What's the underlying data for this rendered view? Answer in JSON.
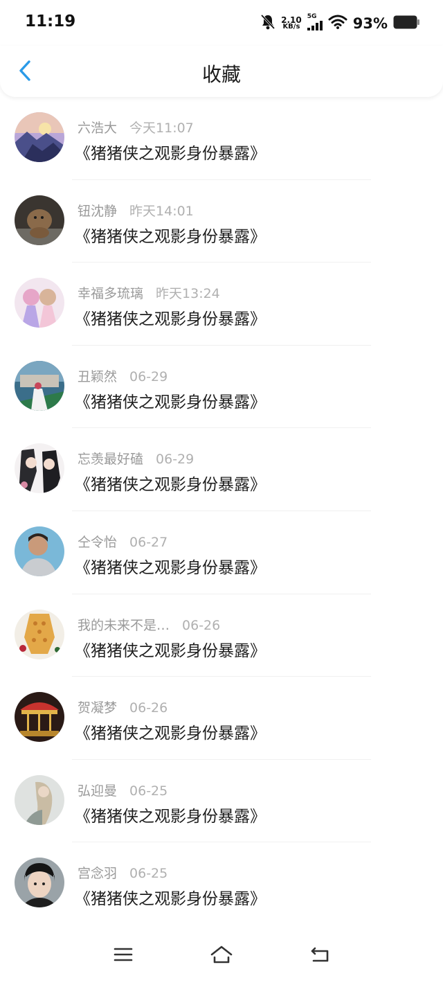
{
  "status_bar": {
    "time": "11:19",
    "net_speed_value": "2.10",
    "net_speed_unit": "KB/s",
    "network_type": "5G",
    "battery_percent": "93%",
    "icons": [
      "bell-muted-icon",
      "signal-icon",
      "wifi-icon",
      "battery-icon"
    ]
  },
  "header": {
    "title": "收藏",
    "back_icon": "chevron-left-icon",
    "accent_color": "#2a9ae8"
  },
  "favorites": [
    {
      "name": "六浩大",
      "time": "今天11:07",
      "title": "《猪猪侠之观影身份暴露》"
    },
    {
      "name": "钮沈静",
      "time": "昨天14:01",
      "title": "《猪猪侠之观影身份暴露》"
    },
    {
      "name": "幸福多琉璃",
      "time": "昨天13:24",
      "title": "《猪猪侠之观影身份暴露》"
    },
    {
      "name": "丑颖然",
      "time": "06-29",
      "title": "《猪猪侠之观影身份暴露》"
    },
    {
      "name": "忘羡最好磕",
      "time": "06-29",
      "title": "《猪猪侠之观影身份暴露》"
    },
    {
      "name": "仝令怡",
      "time": "06-27",
      "title": "《猪猪侠之观影身份暴露》"
    },
    {
      "name": "我的未来不是…",
      "time": "06-26",
      "title": "《猪猪侠之观影身份暴露》"
    },
    {
      "name": "贺凝梦",
      "time": "06-26",
      "title": "《猪猪侠之观影身份暴露》"
    },
    {
      "name": "弘迎曼",
      "time": "06-25",
      "title": "《猪猪侠之观影身份暴露》"
    },
    {
      "name": "宫念羽",
      "time": "06-25",
      "title": "《猪猪侠之观影身份暴露》"
    }
  ],
  "nav_bar": {
    "icons": [
      "menu-icon",
      "home-icon",
      "back-nav-icon"
    ]
  }
}
